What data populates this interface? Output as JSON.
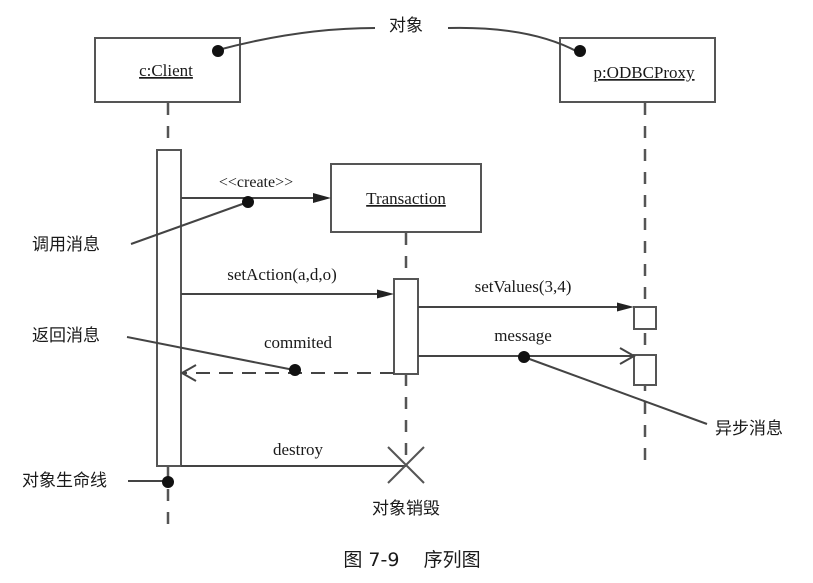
{
  "diagram": {
    "type": "uml-sequence",
    "caption": "图 7-9    序列图",
    "objects": [
      {
        "id": "client",
        "label": "c:Client"
      },
      {
        "id": "transaction",
        "label": "Transaction"
      },
      {
        "id": "proxy",
        "label": "p:ODBCProxy"
      }
    ],
    "messages": [
      {
        "id": "create",
        "label": "<<create>>",
        "from": "client",
        "to": "transaction",
        "kind": "synchronous"
      },
      {
        "id": "setAction",
        "label": "setAction(a,d,o)",
        "from": "client",
        "to": "transaction",
        "kind": "synchronous"
      },
      {
        "id": "setValues",
        "label": "setValues(3,4)",
        "from": "transaction",
        "to": "proxy",
        "kind": "synchronous"
      },
      {
        "id": "message",
        "label": "message",
        "from": "transaction",
        "to": "proxy",
        "kind": "asynchronous"
      },
      {
        "id": "commited",
        "label": "commited",
        "from": "transaction",
        "to": "client",
        "kind": "return"
      },
      {
        "id": "destroy",
        "label": "destroy",
        "from": "client",
        "to": "transaction",
        "kind": "destroy"
      }
    ],
    "annotations": {
      "object": "对象",
      "call_message": "调用消息",
      "return_message": "返回消息",
      "async_message": "异步消息",
      "lifeline": "对象生命线",
      "object_destruction": "对象销毁"
    }
  }
}
